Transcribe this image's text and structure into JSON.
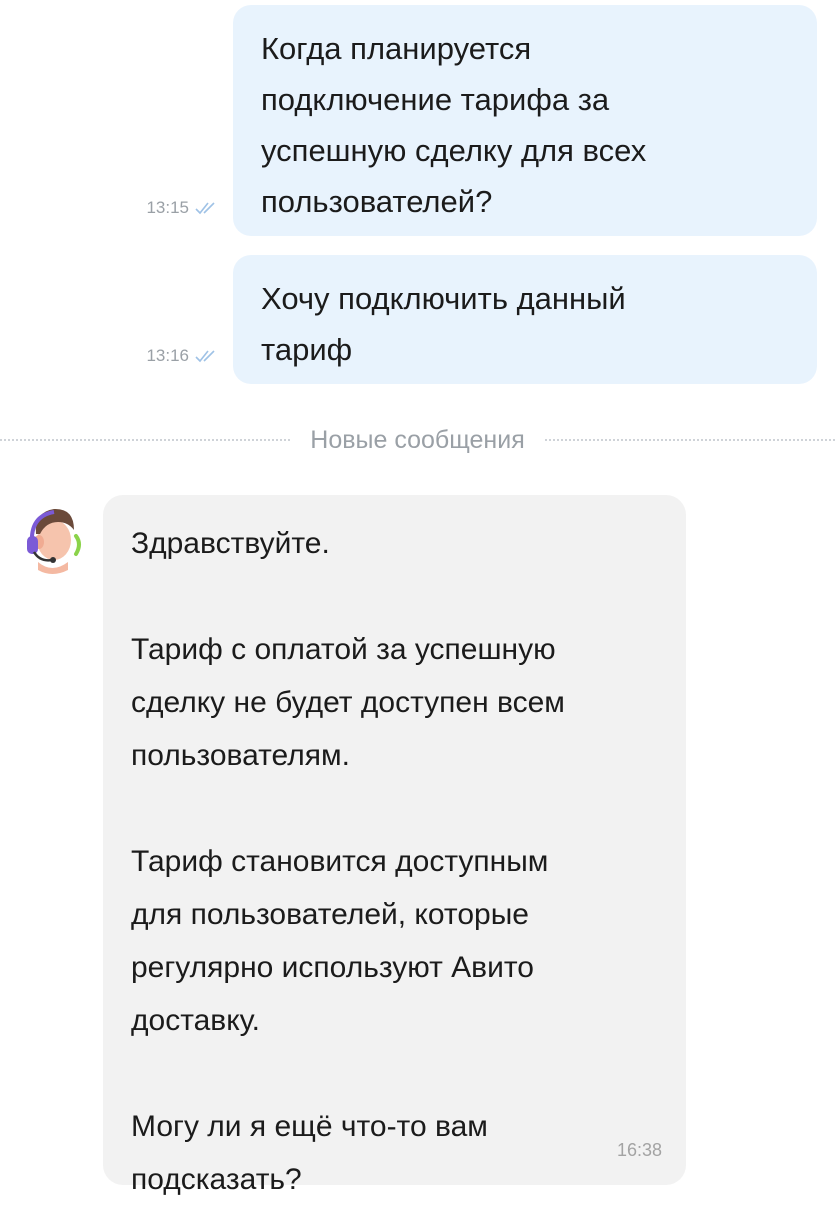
{
  "messages_out": [
    {
      "text": "Когда планируется\nподключение тарифа за\nуспешную сделку для всех\nпользователей?",
      "time": "13:15",
      "status_icon": "double-check-icon"
    },
    {
      "text": "Хочу подключить данный\nтариф",
      "time": "13:16",
      "status_icon": "double-check-icon"
    }
  ],
  "divider": {
    "label": "Новые сообщения"
  },
  "message_in": {
    "avatar": "support-agent-avatar",
    "paragraphs": [
      "Здравствуйте.",
      "Тариф с оплатой за успешную\nсделку не будет доступен всем\nпользователям.",
      "Тариф становится доступным\nдля пользователей, которые\nрегулярно используют Авито\nдоставку.",
      "Могу ли я ещё что-то вам\nподсказать?"
    ],
    "time": "16:38"
  },
  "colors": {
    "outgoing_bubble": "#e8f3fd",
    "incoming_bubble": "#f2f2f2",
    "read_ticks": "#9fc2e6",
    "meta_text": "#9aa0a6"
  }
}
